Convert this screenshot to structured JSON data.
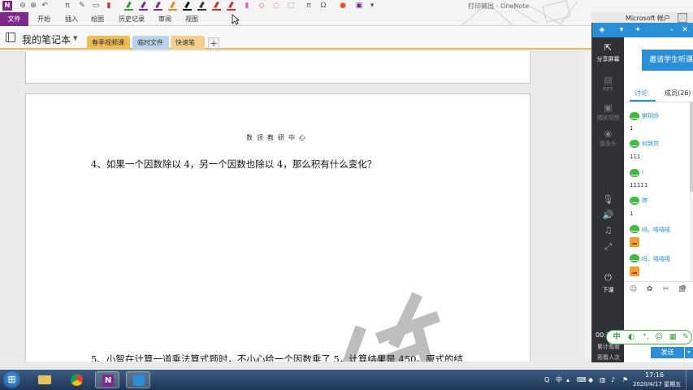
{
  "window": {
    "title": "打印输出 - OneNote",
    "app_logo": "N"
  },
  "quick_access": {
    "icons": [
      "back-icon",
      "forward-icon",
      "undo-icon",
      "pi-icon",
      "ink-to-math-icon",
      "pen-icon"
    ],
    "pi_symbol": "π",
    "pi2_symbol": "π",
    "omega_symbol": "Ω"
  },
  "ribbon": {
    "tabs": [
      "文件",
      "开始",
      "插入",
      "绘图",
      "历史记录",
      "审阅",
      "视图"
    ]
  },
  "notebook": {
    "name": "我的笔记本",
    "sections": [
      "春季视频课",
      "临时文件",
      "快速笔记"
    ],
    "add_label": "+"
  },
  "page": {
    "header": "数领教研中心",
    "question4": "4、如果一个因数除以 4，另一个因数也除以 4，那么积有什么变化？",
    "question5": "5、小智在计算一道乘法算式题时，不小心给一个因数乘了 5，计算结果是 450。原式的结"
  },
  "panel": {
    "account_label": "Microsoft 帐户",
    "share_screen": "分享屏幕",
    "ppt_label": "PPT",
    "play_video": "播放视频",
    "camera": "摄像头",
    "end_class": "下课",
    "timer": "00:22:49",
    "stat1": "累计观看",
    "stat2": "观看人次",
    "invite_button": "邀请学生听课",
    "tabs": {
      "discussion": "讨论",
      "members": "成员(26)"
    },
    "messages": [
      {
        "name": "樊玥妤",
        "text": "1"
      },
      {
        "name": "何致然",
        "text": "111"
      },
      {
        "name": "i",
        "text": "11111"
      },
      {
        "name": "婷",
        "text": "1"
      },
      {
        "name": "吗，嘻嘻嘻",
        "text": ""
      },
      {
        "name": "吗，嘻嘻嘻",
        "text": ""
      }
    ],
    "send_button": "发送",
    "send_caret": "▾"
  },
  "ime": {
    "mode": "中"
  },
  "taskbar": {
    "apps": [
      "windows-explorer",
      "chrome",
      "onenote",
      "classroom-app"
    ],
    "tray_lang": "中",
    "clock_time": "17:16",
    "clock_date": "2020/4/17 星期五"
  },
  "colors": {
    "onenote_purple": "#7d2a8c",
    "accent_blue": "#2b8fd8",
    "wechat_green": "#3dbb3d",
    "section_orange": "#eebb55"
  }
}
